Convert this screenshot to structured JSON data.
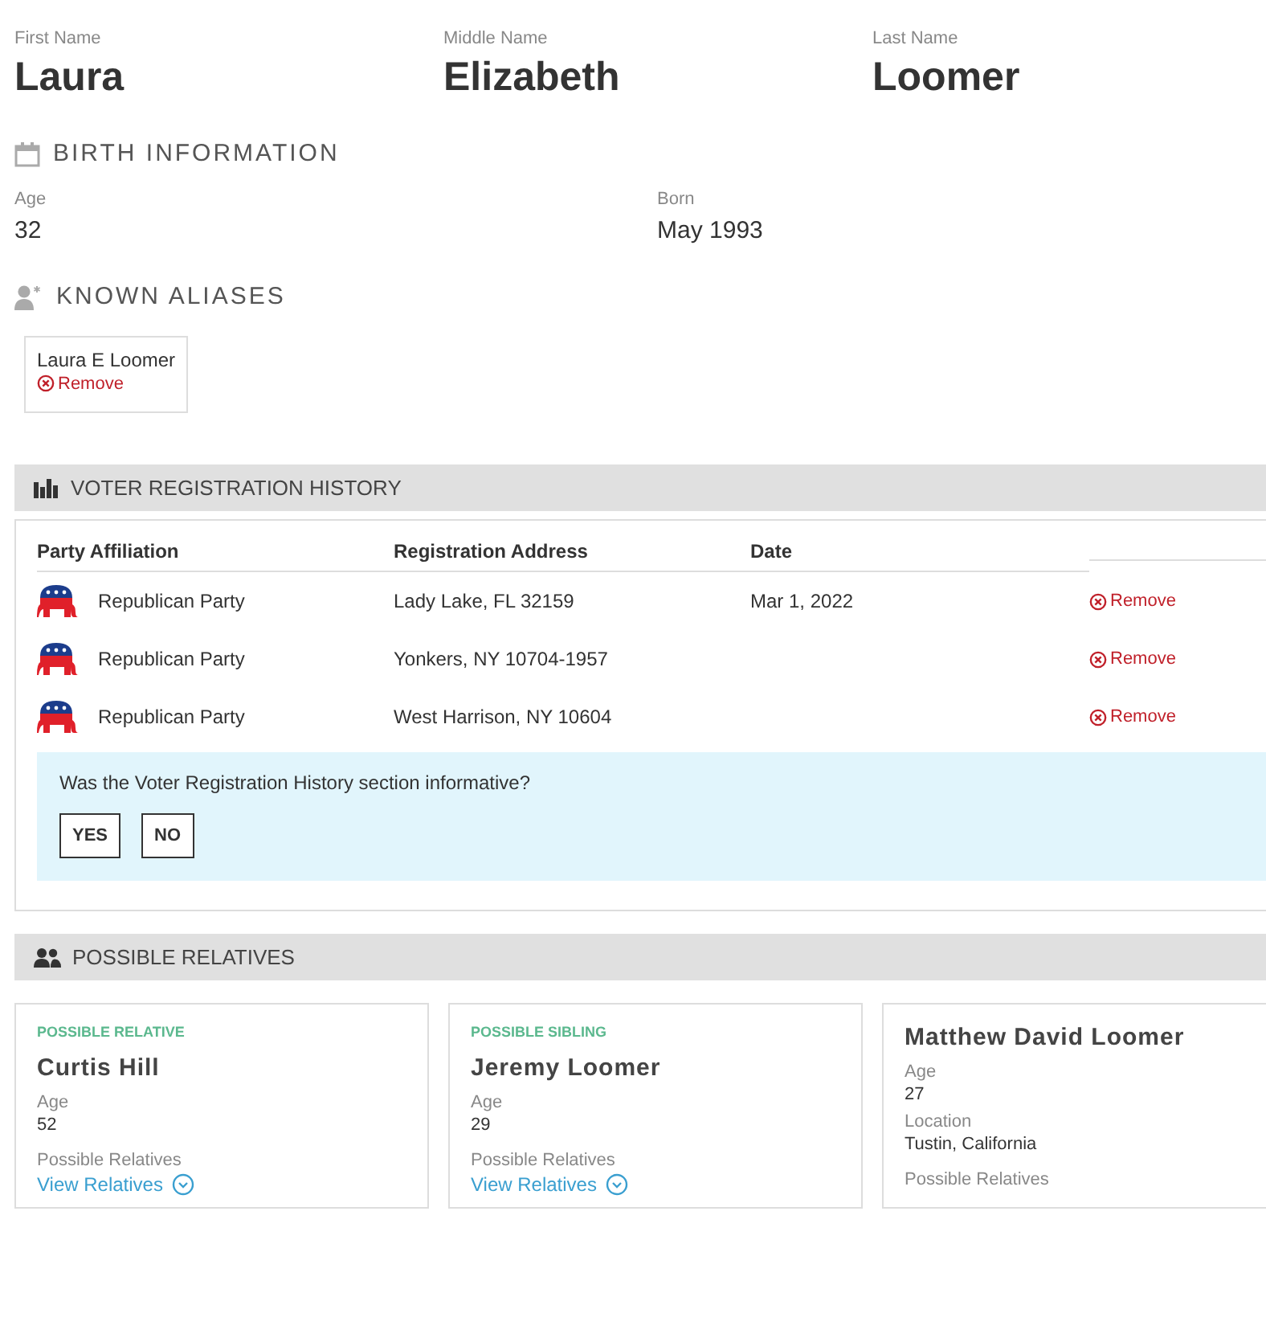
{
  "names": [
    {
      "label": "First Name",
      "value": "Laura"
    },
    {
      "label": "Middle Name",
      "value": "Elizabeth"
    },
    {
      "label": "Last Name",
      "value": "Loomer"
    }
  ],
  "birth": {
    "title": "BIRTH INFORMATION",
    "fields": [
      {
        "label": "Age",
        "value": "32"
      },
      {
        "label": "Born",
        "value": "May 1993"
      }
    ]
  },
  "aliases": {
    "title": "KNOWN ALIASES",
    "items": [
      {
        "name": "Laura E Loomer",
        "remove": "Remove"
      }
    ]
  },
  "voter_registration": {
    "title": "VOTER REGISTRATION HISTORY",
    "columns": [
      "Party Affiliation",
      "Registration Address",
      "Date"
    ],
    "rows": [
      {
        "party": "Republican Party",
        "address": "Lady Lake, FL 32159",
        "date": "Mar 1, 2022",
        "remove": "Remove"
      },
      {
        "party": "Republican Party",
        "address": "Yonkers, NY 10704-1957",
        "remove": "Remove"
      },
      {
        "party": "Republican Party",
        "address": "West Harrison, NY 10604",
        "remove": "Remove"
      }
    ],
    "feedback": {
      "question": "Was the Voter Registration History section informative?",
      "buttons": [
        "YES",
        "NO"
      ]
    }
  },
  "relatives": {
    "title": "POSSIBLE RELATIVES",
    "cards": [
      {
        "tag": "POSSIBLE RELATIVE",
        "name": "Curtis Hill",
        "fields": [
          {
            "label": "Age",
            "value": "52"
          }
        ],
        "relatives_label": "Possible Relatives",
        "link": "View Relatives"
      },
      {
        "tag": "POSSIBLE SIBLING",
        "name": "Jeremy Loomer",
        "fields": [
          {
            "label": "Age",
            "value": "29"
          }
        ],
        "relatives_label": "Possible Relatives",
        "link": "View Relatives"
      },
      {
        "name": "Matthew David Loomer",
        "fields": [
          {
            "label": "Age",
            "value": "27"
          },
          {
            "label": "Location",
            "value": "Tustin, California"
          }
        ],
        "relatives_label": "Possible Relatives"
      }
    ]
  }
}
